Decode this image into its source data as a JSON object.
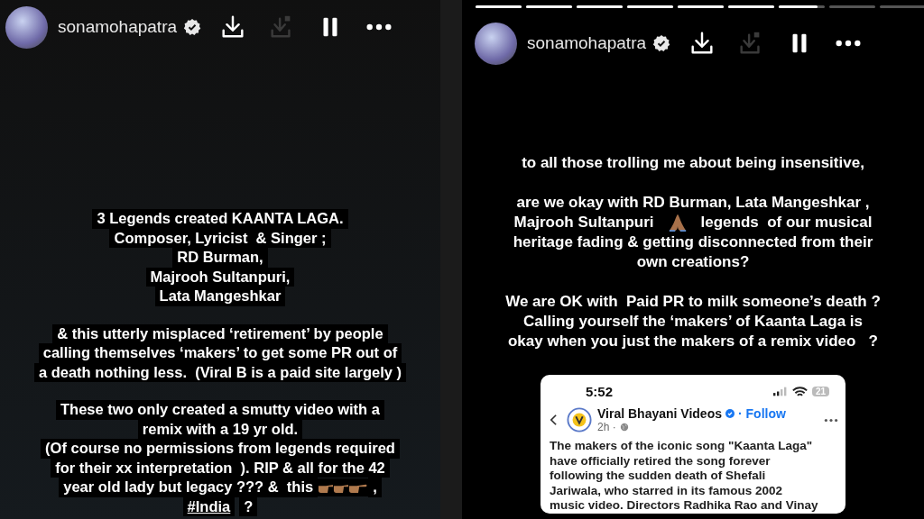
{
  "stories": [
    {
      "user": {
        "username": "sonamohapatra",
        "verified": true
      },
      "actions": [
        {
          "kind": "download"
        },
        {
          "kind": "save"
        },
        {
          "kind": "pause"
        },
        {
          "kind": "more"
        }
      ],
      "paragraphs": [
        [
          [
            {
              "kind": "text",
              "text": "3 Legends created KAANTA LAGA."
            }
          ],
          [
            {
              "kind": "text",
              "text": "Composer, Lyricist  & Singer ;"
            }
          ],
          [
            {
              "kind": "text",
              "text": "RD Burman,"
            }
          ],
          [
            {
              "kind": "text",
              "text": "Majrooh Sultanpuri,"
            }
          ],
          [
            {
              "kind": "text",
              "text": "Lata Mangeshkar"
            }
          ]
        ],
        [
          [
            {
              "kind": "text",
              "text": "& this utterly misplaced ‘retirement’ by people"
            }
          ],
          [
            {
              "kind": "text",
              "text": "calling themselves ‘makers’ to get some PR out of"
            }
          ],
          [
            {
              "kind": "text",
              "text": "a death nothing less.  (Viral B is a paid site largely )"
            }
          ]
        ],
        [
          [
            {
              "kind": "text",
              "text": "These two only created a smutty video with a"
            }
          ],
          [
            {
              "kind": "text",
              "text": "remix with a 19 yr old."
            }
          ],
          [
            {
              "kind": "text",
              "text": "(Of course no permissions from legends required"
            }
          ],
          [
            {
              "kind": "text",
              "text": "for their xx interpretation  ). RIP & all for the 42"
            }
          ],
          [
            {
              "kind": "text",
              "text": "year old lady but legacy ??? &  this"
            },
            {
              "kind": "pointing-hand"
            },
            {
              "kind": "pointing-hand"
            },
            {
              "kind": "pointing-hand"
            },
            {
              "kind": "text",
              "text": ","
            }
          ],
          [
            {
              "kind": "hashtag",
              "text": "#India"
            },
            {
              "kind": "text",
              "text": "?"
            }
          ]
        ]
      ]
    },
    {
      "progress": [
        {
          "level": 1
        },
        {
          "level": 1
        },
        {
          "level": 1
        },
        {
          "level": 1
        },
        {
          "level": 1
        },
        {
          "level": 1
        },
        {
          "level": 0.85
        },
        {
          "level": 0
        },
        {
          "level": 0
        }
      ],
      "user": {
        "username": "sonamohapatra",
        "verified": true
      },
      "actions": [
        {
          "kind": "download"
        },
        {
          "kind": "save"
        },
        {
          "kind": "pause"
        },
        {
          "kind": "more"
        }
      ],
      "paragraphs": [
        [
          [
            {
              "kind": "text",
              "text": "to all those trolling me about being insensitive,"
            }
          ]
        ],
        [
          [
            {
              "kind": "text",
              "text": "are we okay with RD Burman, Lata Mangeshkar ,"
            }
          ],
          [
            {
              "kind": "text",
              "text": "Majrooh Sultanpuri"
            },
            {
              "kind": "praying-hands"
            },
            {
              "kind": "text",
              "text": "legends  of our musical"
            }
          ],
          [
            {
              "kind": "text",
              "text": "heritage fading & getting disconnected from their"
            }
          ],
          [
            {
              "kind": "text",
              "text": "own creations?"
            }
          ]
        ],
        [
          [
            {
              "kind": "text",
              "text": "We are OK with  Paid PR to milk someone’s death ?"
            }
          ],
          [
            {
              "kind": "text",
              "text": "Calling yourself the ‘makers’ of Kaanta Laga is"
            }
          ],
          [
            {
              "kind": "text",
              "text": "okay when you just the makers of a remix video   ?"
            }
          ]
        ]
      ],
      "post": {
        "time": "5:52",
        "battery": "21",
        "author": "Viral Bhayani Videos",
        "verified": true,
        "follow": "· Follow",
        "age": "2h ·",
        "body": "The makers of the iconic song \"Kaanta Laga\"\nhave officially retired the song forever\nfollowing the sudden death of Shefali\nJariwala, who starred in its famous 2002\nmusic video. Directors Radhika Rao and Vinay"
      }
    }
  ]
}
